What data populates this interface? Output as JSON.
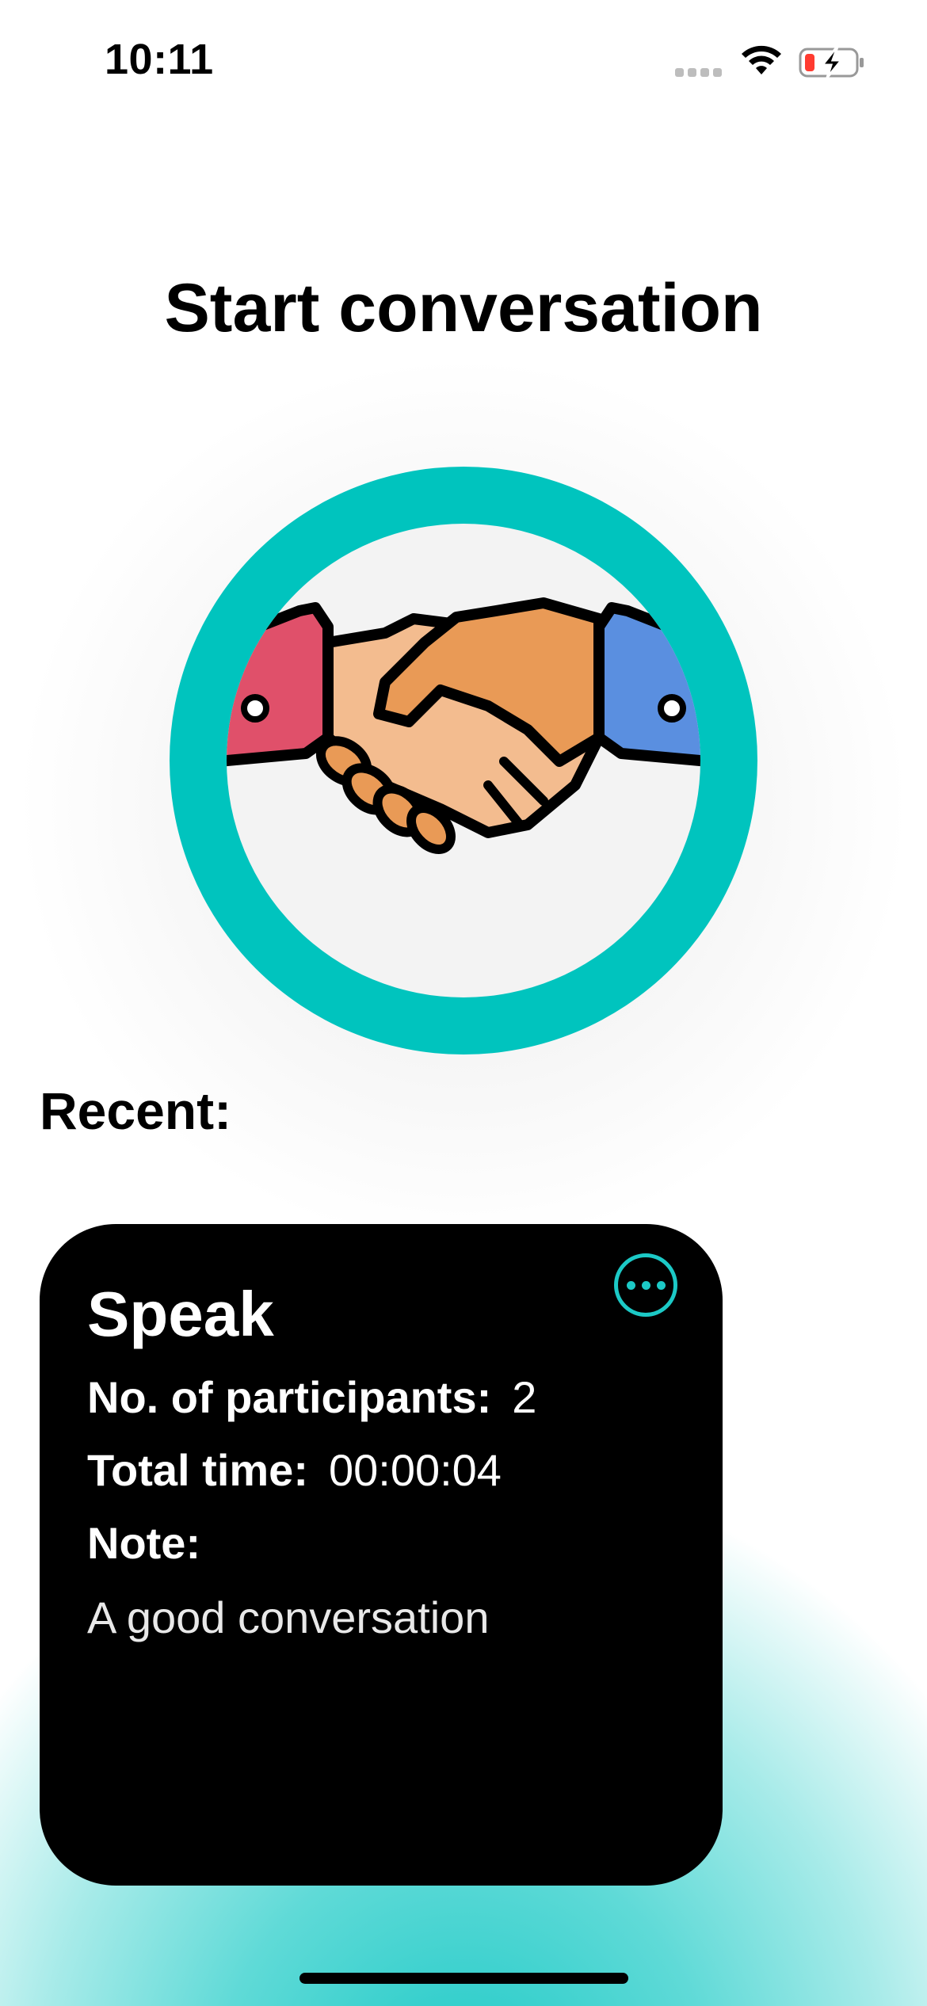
{
  "status_bar": {
    "time": "10:11",
    "icons": [
      "cellular-signal-icon",
      "wifi-icon",
      "battery-charging-icon"
    ],
    "battery_level_color": "#ff3b30"
  },
  "header": {
    "title": "Start conversation"
  },
  "hero": {
    "icon": "handshake-icon",
    "ring_color": "#00c4be"
  },
  "recent": {
    "label": "Recent:",
    "card": {
      "title": "Speak",
      "participants_label": "No. of participants:",
      "participants_value": "2",
      "time_label": "Total time:",
      "time_value": "00:00:04",
      "note_label": "Note:",
      "note_value": "A good conversation",
      "more_icon": "more-icon",
      "accent": "#1cc9c6"
    }
  }
}
